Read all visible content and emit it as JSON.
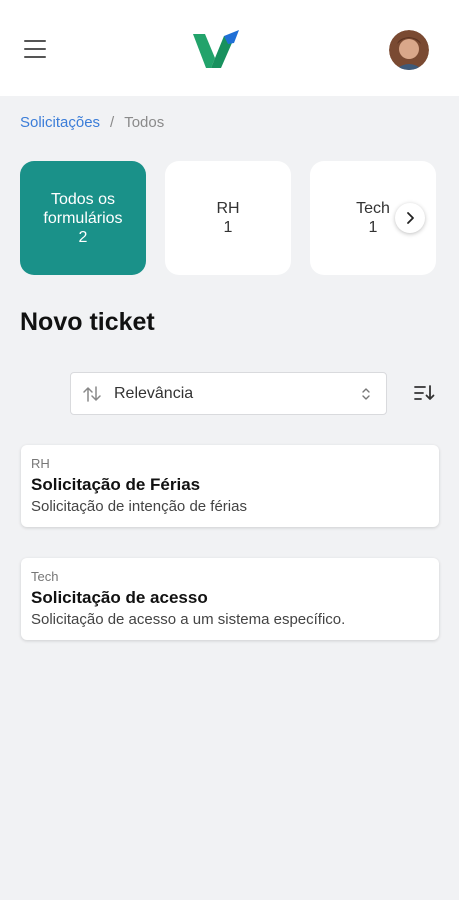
{
  "header": {
    "menu_icon": "hamburger-menu-icon",
    "logo_icon": "brand-v-logo",
    "avatar_icon": "user-avatar",
    "colors": {
      "logo_green": "#22a36b",
      "logo_blue": "#1f6fd6"
    }
  },
  "breadcrumb": {
    "parent": "Solicitações",
    "separator": "/",
    "current": "Todos"
  },
  "categories": {
    "items": [
      {
        "label": "Todos os formulários",
        "count": "2",
        "active": true
      },
      {
        "label": "RH",
        "count": "1",
        "active": false
      },
      {
        "label": "Tech",
        "count": "1",
        "active": false
      }
    ],
    "next_icon": "chevron-right-icon",
    "active_color": "#1a9189"
  },
  "page": {
    "title": "Novo ticket"
  },
  "sort": {
    "value": "Relevância",
    "sort_icon": "arrows-up-down-icon",
    "select_icon": "chevron-up-down-icon",
    "order_icon": "sort-order-icon"
  },
  "tickets": [
    {
      "category": "RH",
      "title": "Solicitação de Férias",
      "description": "Solicitação de intenção de férias"
    },
    {
      "category": "Tech",
      "title": "Solicitação de acesso",
      "description": "Solicitação de acesso a um sistema específico."
    }
  ]
}
